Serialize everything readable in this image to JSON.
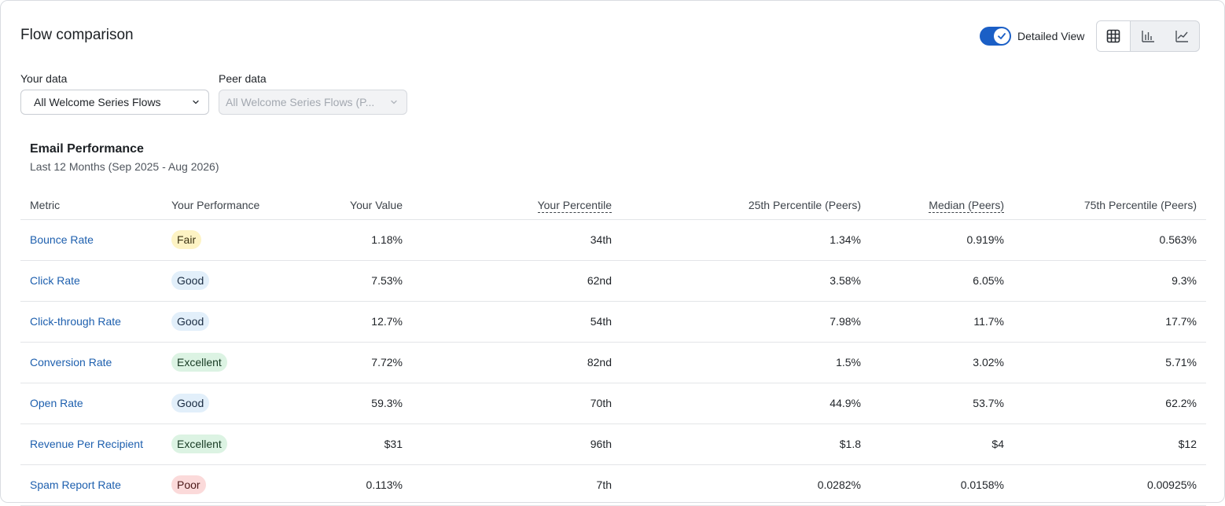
{
  "header": {
    "title": "Flow comparison",
    "detailed_view_label": "Detailed View",
    "detailed_view_on": true,
    "view_modes": [
      "table-icon",
      "bar-chart-icon",
      "line-chart-icon"
    ],
    "active_view": "table"
  },
  "filters": {
    "your_data_label": "Your data",
    "your_data_value": "All Welcome Series Flows",
    "peer_data_label": "Peer data",
    "peer_data_value": "All Welcome Series Flows (P..."
  },
  "section": {
    "title": "Email Performance",
    "subtitle": "Last 12 Months (Sep 2025 - Aug 2026)"
  },
  "table": {
    "columns": [
      "Metric",
      "Your Performance",
      "Your Value",
      "Your Percentile",
      "25th Percentile (Peers)",
      "Median (Peers)",
      "75th Percentile (Peers)"
    ],
    "rows": [
      {
        "metric": "Bounce Rate",
        "performance": "Fair",
        "value": "1.18%",
        "percentile": "34th",
        "p25": "1.34%",
        "median": "0.919%",
        "p75": "0.563%"
      },
      {
        "metric": "Click Rate",
        "performance": "Good",
        "value": "7.53%",
        "percentile": "62nd",
        "p25": "3.58%",
        "median": "6.05%",
        "p75": "9.3%"
      },
      {
        "metric": "Click-through Rate",
        "performance": "Good",
        "value": "12.7%",
        "percentile": "54th",
        "p25": "7.98%",
        "median": "11.7%",
        "p75": "17.7%"
      },
      {
        "metric": "Conversion Rate",
        "performance": "Excellent",
        "value": "7.72%",
        "percentile": "82nd",
        "p25": "1.5%",
        "median": "3.02%",
        "p75": "5.71%"
      },
      {
        "metric": "Open Rate",
        "performance": "Good",
        "value": "59.3%",
        "percentile": "70th",
        "p25": "44.9%",
        "median": "53.7%",
        "p75": "62.2%"
      },
      {
        "metric": "Revenue Per Recipient",
        "performance": "Excellent",
        "value": "$31",
        "percentile": "96th",
        "p25": "$1.8",
        "median": "$4",
        "p75": "$12"
      },
      {
        "metric": "Spam Report Rate",
        "performance": "Poor",
        "value": "0.113%",
        "percentile": "7th",
        "p25": "0.0282%",
        "median": "0.0158%",
        "p75": "0.00925%"
      }
    ]
  },
  "colors": {
    "accent": "#1b5fc6",
    "link": "#1d5fae",
    "fair": "#fdf3c4",
    "good": "#e2effa",
    "excellent": "#dcf3e3",
    "poor": "#fbdada"
  }
}
